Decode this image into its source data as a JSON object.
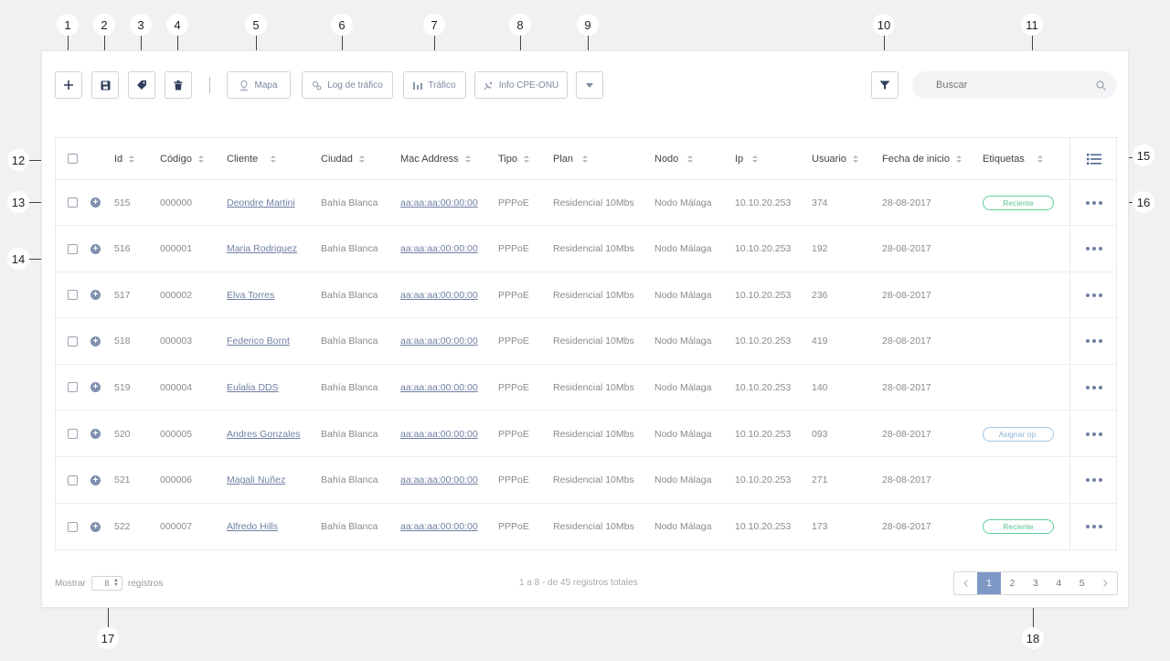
{
  "callouts": [
    "1",
    "2",
    "3",
    "4",
    "5",
    "6",
    "7",
    "8",
    "9",
    "10",
    "11",
    "12",
    "13",
    "14",
    "15",
    "16",
    "17",
    "18"
  ],
  "toolbar": {
    "mapa": "Mapa",
    "log": "Log de tráfico",
    "trafico": "Tráfico",
    "info": "Info CPE-ONU"
  },
  "search": {
    "placeholder": "Buscar"
  },
  "columns": {
    "id": "Id",
    "codigo": "Código",
    "cliente": "Cliente",
    "ciudad": "Ciudad",
    "mac": "Mac Address",
    "tipo": "Tipo",
    "plan": "Plan",
    "nodo": "Nodo",
    "ip": "Ip",
    "usuario": "Usuario",
    "fecha": "Fecha de inicio",
    "etiquetas": "Etiquetas"
  },
  "rows": [
    {
      "id": "515",
      "codigo": "000000",
      "cliente": "Deondre Martini",
      "ciudad": "Bahía Blanca",
      "mac": "aa:aa:aa:00:00:00",
      "tipo": "PPPoE",
      "plan": "Residencial 10Mbs",
      "nodo": "Nodo Málaga",
      "ip": "10.10.20.253",
      "usuario": "374",
      "fecha": "28-08-2017",
      "tag": "Reciente"
    },
    {
      "id": "516",
      "codigo": "000001",
      "cliente": "Maria Rodriguez",
      "ciudad": "Bahía Blanca",
      "mac": "aa:aa:aa:00:00:00",
      "tipo": "PPPoE",
      "plan": "Residencial 10Mbs",
      "nodo": "Nodo Málaga",
      "ip": "10.10.20.253",
      "usuario": "192",
      "fecha": "28-08-2017",
      "tag": ""
    },
    {
      "id": "517",
      "codigo": "000002",
      "cliente": "Elva Torres",
      "ciudad": "Bahía Blanca",
      "mac": "aa:aa:aa:00:00:00",
      "tipo": "PPPoE",
      "plan": "Residencial 10Mbs",
      "nodo": "Nodo Málaga",
      "ip": "10.10.20.253",
      "usuario": "236",
      "fecha": "28-08-2017",
      "tag": ""
    },
    {
      "id": "518",
      "codigo": "000003",
      "cliente": "Federico Bornt",
      "ciudad": "Bahía Blanca",
      "mac": "aa:aa:aa:00:00:00",
      "tipo": "PPPoE",
      "plan": "Residencial 10Mbs",
      "nodo": "Nodo Málaga",
      "ip": "10.10.20.253",
      "usuario": "419",
      "fecha": "28-08-2017",
      "tag": ""
    },
    {
      "id": "519",
      "codigo": "000004",
      "cliente": "Eulalia DDS",
      "ciudad": "Bahía Blanca",
      "mac": "aa:aa:aa:00:00:00",
      "tipo": "PPPoE",
      "plan": "Residencial 10Mbs",
      "nodo": "Nodo Málaga",
      "ip": "10.10.20.253",
      "usuario": "140",
      "fecha": "28-08-2017",
      "tag": ""
    },
    {
      "id": "520",
      "codigo": "000005",
      "cliente": "Andres Gonzales",
      "ciudad": "Bahía Blanca",
      "mac": "aa:aa:aa:00:00:00",
      "tipo": "PPPoE",
      "plan": "Residencial 10Mbs",
      "nodo": "Nodo Málaga",
      "ip": "10.10.20.253",
      "usuario": "093",
      "fecha": "28-08-2017",
      "tag": "Asignar op."
    },
    {
      "id": "521",
      "codigo": "000006",
      "cliente": "Magali Nuñez",
      "ciudad": "Bahía Blanca",
      "mac": "aa:aa:aa:00:00:00",
      "tipo": "PPPoE",
      "plan": "Residencial 10Mbs",
      "nodo": "Nodo Málaga",
      "ip": "10.10.20.253",
      "usuario": "271",
      "fecha": "28-08-2017",
      "tag": ""
    },
    {
      "id": "522",
      "codigo": "000007",
      "cliente": "Alfredo Hills",
      "ciudad": "Bahía Blanca",
      "mac": "aa:aa:aa:00:00:00",
      "tipo": "PPPoE",
      "plan": "Residencial 10Mbs",
      "nodo": "Nodo Málaga",
      "ip": "10.10.20.253",
      "usuario": "173",
      "fecha": "28-08-2017",
      "tag": "Reciente"
    }
  ],
  "footer": {
    "mostrar": "Mostrar",
    "per_page": "8",
    "registros": "registros",
    "summary": "1 a 8 - de 45 registros totales",
    "pages": [
      "1",
      "2",
      "3",
      "4",
      "5"
    ],
    "current_page": "1"
  },
  "colors": {
    "accent": "#7f99c6",
    "link": "#6f7fa3",
    "tag_green": "#5fcf95",
    "tag_blue": "#9fc6e6"
  },
  "icons": [
    "plus-icon",
    "save-icon",
    "tag-icon",
    "trash-icon",
    "map-pin-icon",
    "gears-icon",
    "bar-chart-icon",
    "satellite-icon",
    "chevron-down-icon",
    "filter-icon",
    "search-icon",
    "columns-list-icon",
    "more-icon",
    "expand-icon",
    "chevron-left-icon",
    "chevron-right-icon"
  ]
}
